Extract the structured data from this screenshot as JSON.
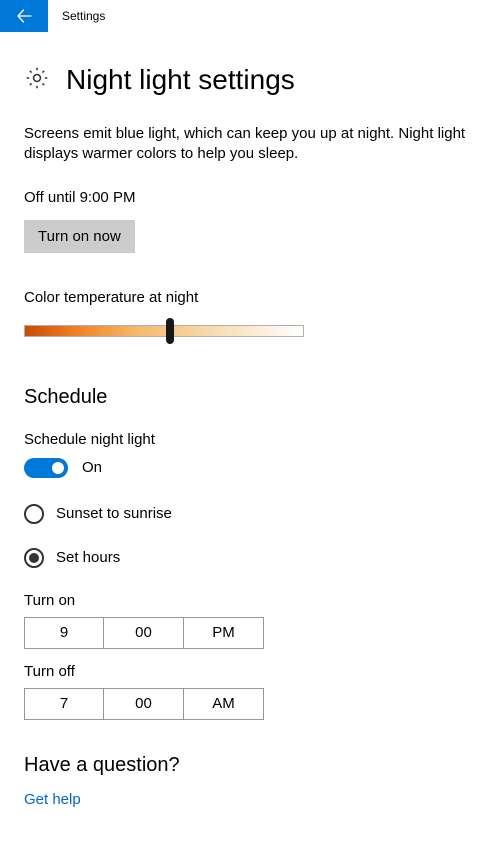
{
  "titlebar": {
    "label": "Settings"
  },
  "page": {
    "title": "Night light settings",
    "description": "Screens emit blue light, which can keep you up at night. Night light displays warmer colors to help you sleep.",
    "status": "Off until 9:00 PM",
    "turn_on_label": "Turn on now"
  },
  "color_temp": {
    "label": "Color temperature at night",
    "value_percent": 52
  },
  "schedule": {
    "header": "Schedule",
    "toggle_label": "Schedule night light",
    "toggle_state": "On",
    "option_sunset": "Sunset to sunrise",
    "option_sethours": "Set hours",
    "selected": "set_hours",
    "turn_on": {
      "label": "Turn on",
      "hour": "9",
      "minute": "00",
      "ampm": "PM"
    },
    "turn_off": {
      "label": "Turn off",
      "hour": "7",
      "minute": "00",
      "ampm": "AM"
    }
  },
  "help": {
    "header": "Have a question?",
    "link": "Get help"
  }
}
